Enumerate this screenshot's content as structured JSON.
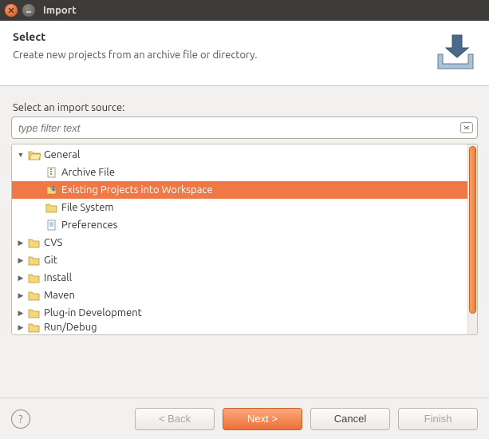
{
  "window": {
    "title": "Import"
  },
  "header": {
    "title": "Select",
    "subtitle": "Create new projects from an archive file or directory."
  },
  "filter": {
    "label": "Select an import source:",
    "placeholder": "type filter text"
  },
  "tree": {
    "general": {
      "label": "General",
      "children": {
        "archive": "Archive File",
        "existing": "Existing Projects into Workspace",
        "filesystem": "File System",
        "prefs": "Preferences"
      }
    },
    "cvs": "CVS",
    "git": "Git",
    "install": "Install",
    "maven": "Maven",
    "plugin": "Plug-in Development",
    "rundebug": "Run/Debug"
  },
  "buttons": {
    "back": "< Back",
    "next": "Next >",
    "cancel": "Cancel",
    "finish": "Finish"
  }
}
